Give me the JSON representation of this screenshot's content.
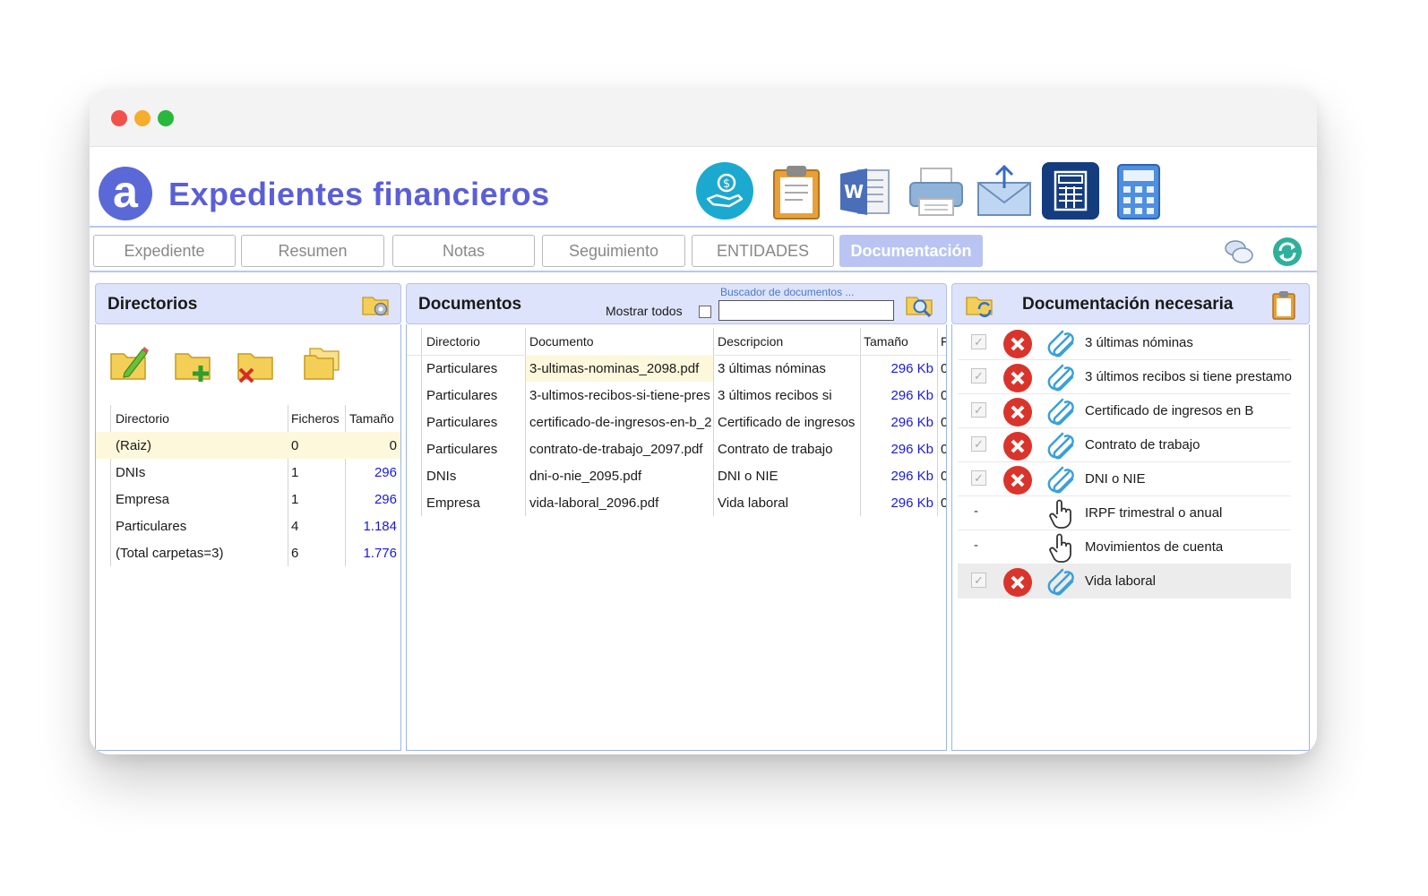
{
  "app": {
    "title": "Expedientes financieros",
    "logo_letter": "a"
  },
  "toolbar_icons": [
    "money-hand-icon",
    "clipboard-icon",
    "word-document-icon",
    "printer-icon",
    "email-icon",
    "calculator-dark-icon",
    "calculator-icon"
  ],
  "tabs": [
    "Expediente",
    "Resumen",
    "Notas",
    "Seguimiento",
    "ENTIDADES",
    "Documentación"
  ],
  "active_tab": "Documentación",
  "directorios": {
    "title": "Directorios",
    "columns": [
      "Directorio",
      "Ficheros",
      "Tamaño"
    ],
    "rows": [
      {
        "dir": "(Raiz)",
        "files": "0",
        "size": "0"
      },
      {
        "dir": "DNIs",
        "files": "1",
        "size": "296"
      },
      {
        "dir": "Empresa",
        "files": "1",
        "size": "296"
      },
      {
        "dir": "Particulares",
        "files": "4",
        "size": "1.184"
      },
      {
        "dir": "(Total carpetas=3)",
        "files": "6",
        "size": "1.776"
      }
    ]
  },
  "documentos": {
    "title": "Documentos",
    "show_all_label": "Mostrar todos",
    "search_label": "Buscador de documentos ...",
    "columns": [
      "Directorio",
      "Documento",
      "Descripcion",
      "Tamaño",
      "F"
    ],
    "rows": [
      {
        "dir": "Particulares",
        "doc": "3-ultimas-nominas_2098.pdf",
        "desc": "3 últimas nóminas",
        "size": "296 Kb",
        "f": "0"
      },
      {
        "dir": "Particulares",
        "doc": "3-ultimos-recibos-si-tiene-pres",
        "desc": "3 últimos recibos si",
        "size": "296 Kb",
        "f": "0"
      },
      {
        "dir": "Particulares",
        "doc": "certificado-de-ingresos-en-b_2",
        "desc": "Certificado de ingresos",
        "size": "296 Kb",
        "f": "0"
      },
      {
        "dir": "Particulares",
        "doc": "contrato-de-trabajo_2097.pdf",
        "desc": "Contrato de trabajo",
        "size": "296 Kb",
        "f": "0"
      },
      {
        "dir": "DNIs",
        "doc": "dni-o-nie_2095.pdf",
        "desc": "DNI o NIE",
        "size": "296 Kb",
        "f": "0"
      },
      {
        "dir": "Empresa",
        "doc": "vida-laboral_2096.pdf",
        "desc": "Vida laboral",
        "size": "296 Kb",
        "f": "0"
      }
    ]
  },
  "necesaria": {
    "title": "Documentación necesaria",
    "items": [
      {
        "label": "3 últimas nóminas",
        "status": "attached",
        "check": "✓"
      },
      {
        "label": "3 últimos recibos si tiene prestamo",
        "status": "attached",
        "check": "✓"
      },
      {
        "label": "Certificado de ingresos en B",
        "status": "attached",
        "check": "✓"
      },
      {
        "label": "Contrato de trabajo",
        "status": "attached",
        "check": "✓"
      },
      {
        "label": "DNI o NIE",
        "status": "attached",
        "check": "✓"
      },
      {
        "label": "IRPF trimestral o anual",
        "status": "pending",
        "check": "-"
      },
      {
        "label": "Movimientos de cuenta",
        "status": "pending",
        "check": "-"
      },
      {
        "label": "Vida laboral",
        "status": "attached",
        "check": "✓"
      }
    ]
  },
  "colors": {
    "accent": "#5a5fd6",
    "active_tab": "#b9c4f2",
    "panel_header": "#dde3fb",
    "number": "#1a1ad9",
    "selected_row": "#fdf8dc"
  }
}
